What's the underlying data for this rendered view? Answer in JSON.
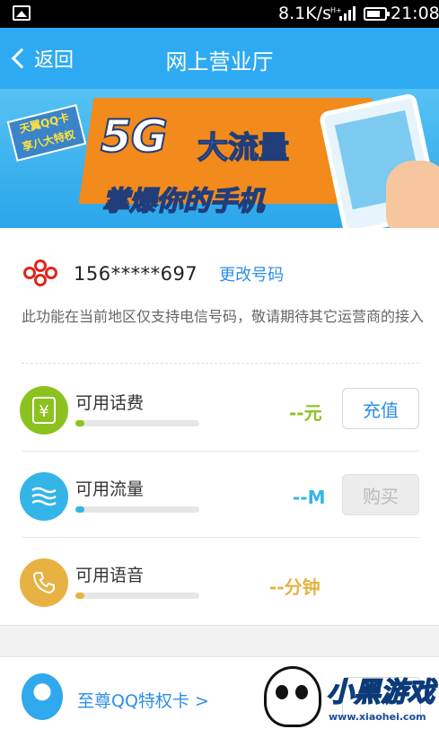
{
  "status_bar": {
    "speed": "8.1K/s",
    "time": "21:08"
  },
  "nav": {
    "back_label": "返回",
    "title": "网上营业厅"
  },
  "banner": {
    "tag_line1": "天翼QQ卡",
    "tag_line2": "享八大特权",
    "headline_5g": "5G",
    "headline_flow": "大流量",
    "slogan": "掌爆你的手机"
  },
  "account": {
    "phone_number": "156*****697",
    "change_label": "更改号码",
    "notice": "此功能在当前地区仅支持电信号码，敬请期待其它运营商的接入"
  },
  "balances": [
    {
      "label": "可用话费",
      "value": "--",
      "unit": "元",
      "button": "充值",
      "color": "#8cc21f",
      "fill_fraction": 0.07
    },
    {
      "label": "可用流量",
      "value": "--",
      "unit": "M",
      "button": "购买",
      "color": "#33b5e8",
      "fill_fraction": 0.07
    },
    {
      "label": "可用语音",
      "value": "--",
      "unit": "分钟",
      "color": "#e8b243",
      "fill_fraction": 0.07
    }
  ],
  "qq_card": {
    "label": "至尊QQ特权卡 >"
  },
  "watermark": {
    "brand": "小黑游戏",
    "site": "www.xiaohei.com"
  }
}
